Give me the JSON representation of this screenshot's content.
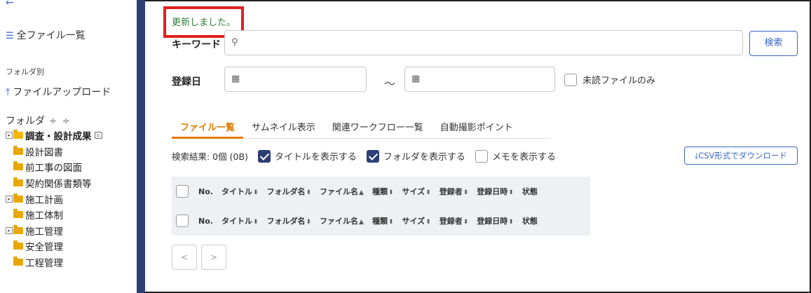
{
  "sidebar": {
    "back_icon": "←",
    "all_files": "全ファイル一覧",
    "by_folder": "フォルダ別",
    "upload": "ファイルアップロード",
    "folder_header": "フォルダ",
    "tree": [
      {
        "label": "調査・設計成果",
        "active": true,
        "expander": true
      },
      {
        "label": "設計図書",
        "active": false,
        "expander": false
      },
      {
        "label": "前工事の図面",
        "active": false,
        "expander": false
      },
      {
        "label": "契約関係書類等",
        "active": false,
        "expander": false
      },
      {
        "label": "施工計画",
        "active": false,
        "expander": true
      },
      {
        "label": "施工体制",
        "active": false,
        "expander": false
      },
      {
        "label": "施工管理",
        "active": false,
        "expander": true
      },
      {
        "label": "安全管理",
        "active": false,
        "expander": false
      },
      {
        "label": "工程管理",
        "active": false,
        "expander": false
      }
    ]
  },
  "notice": "更新しました。",
  "search": {
    "keyword_label": "キーワード",
    "keyword_value": "",
    "button": "検索",
    "date_label": "登録日",
    "tilde": "～",
    "unread_only": "未読ファイルのみ"
  },
  "tabs": [
    {
      "label": "ファイル一覧",
      "active": true
    },
    {
      "label": "サムネイル表示",
      "active": false
    },
    {
      "label": "関連ワークフロー一覧",
      "active": false
    },
    {
      "label": "自動撮影ポイント",
      "active": false
    }
  ],
  "results": {
    "summary": "検索結果: 0個 (0B)",
    "show_title": "タイトルを表示する",
    "show_folder": "フォルダを表示する",
    "show_memo": "メモを表示する",
    "csv": "CSV形式でダウンロード"
  },
  "table": {
    "columns": [
      "No.",
      "タイトル",
      "フォルダ名",
      "ファイル名",
      "種類",
      "サイズ",
      "登録者",
      "登録日時",
      "状態"
    ]
  },
  "pager": {
    "prev": "<",
    "next": ">"
  },
  "colors": {
    "accent": "#e07b00",
    "navy": "#2d3e73",
    "link": "#3a66c4",
    "notice": "#2e7d32",
    "highlight": "#e02020"
  }
}
